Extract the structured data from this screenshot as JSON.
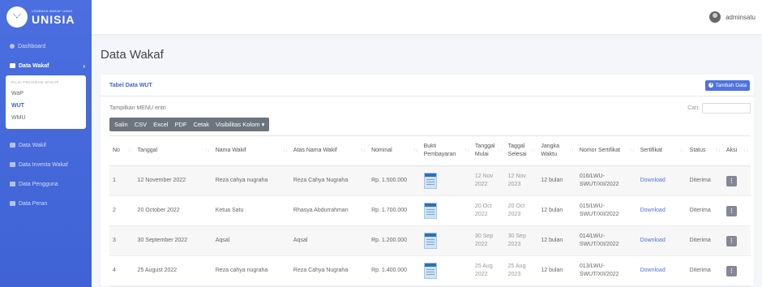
{
  "brand": {
    "small": "LEMBAGA WAKAF UANG",
    "big": "UNISIA"
  },
  "topbar": {
    "username": "adminsatu"
  },
  "sidebar": {
    "items": [
      {
        "label": "Dashboard",
        "icon": "dashboard-icon"
      },
      {
        "label": "Data Wakaf",
        "icon": "folder-icon",
        "active": true
      },
      {
        "label": "Data Wakif",
        "icon": "folder-icon"
      },
      {
        "label": "Data Investa Wakaf",
        "icon": "folder-icon"
      },
      {
        "label": "Data Pengguna",
        "icon": "folder-icon"
      },
      {
        "label": "Data Peran",
        "icon": "folder-icon"
      }
    ],
    "submenu": {
      "heading": "PILIH PROGRAM WAKAF",
      "items": [
        "WaP",
        "WUT",
        "WMU"
      ]
    }
  },
  "page": {
    "title": "Data Wakaf"
  },
  "card": {
    "title": "Tabel Data WUT",
    "add_button": "Tambah Data",
    "show_entries": "Tampilkan MENU entri",
    "search_label": "Cari:",
    "buttons": [
      "Salin",
      "CSV",
      "Excel",
      "PDF",
      "Cetak",
      "Visibilitas Kolom ▾"
    ]
  },
  "table": {
    "headers": [
      "No",
      "Tanggal",
      "Nama Wakif",
      "Atas Nama Wakif",
      "Nominal",
      "Bukti Pembayaran",
      "Tanggal Mulai",
      "Taggal Selesai",
      "Jangka Waktu",
      "Nomor Sertifikat",
      "Sertifikat",
      "Status",
      "Aksi"
    ],
    "rows": [
      {
        "no": "1",
        "tanggal": "12 November 2022",
        "nama": "Reza cahya nugraha",
        "atas": "Reza Cahya Nugraha",
        "nominal": "Rp. 1.500.000",
        "mulai": "12 Nov 2022",
        "selesai": "12 Nov 2023",
        "jangka": "12 bulan",
        "nomor": "016/LWU-SWUT/XII/2022",
        "sertifikat": "Download",
        "status": "Diterima",
        "aksi": "⋮"
      },
      {
        "no": "2",
        "tanggal": "20 October 2022",
        "nama": "Ketua Satu",
        "atas": "Rhasya Abdurrahman",
        "nominal": "Rp. 1.700.000",
        "mulai": "20 Oct 2022",
        "selesai": "20 Oct 2023",
        "jangka": "12 bulan",
        "nomor": "015/LWU-SWUT/XII/2022",
        "sertifikat": "Download",
        "status": "Diterima",
        "aksi": "⋮"
      },
      {
        "no": "3",
        "tanggal": "30 September 2022",
        "nama": "Aqsal",
        "atas": "Aqsal",
        "nominal": "Rp. 1.200.000",
        "mulai": "30 Sep 2022",
        "selesai": "30 Sep 2023",
        "jangka": "12 bulan",
        "nomor": "014/LWU-SWUT/XII/2022",
        "sertifikat": "Download",
        "status": "Diterima",
        "aksi": "⋮"
      },
      {
        "no": "4",
        "tanggal": "25 August 2022",
        "nama": "Reza cahya nugraha",
        "atas": "Reza Cahya Nugraha",
        "nominal": "Rp. 1.400.000",
        "mulai": "25 Aug 2022",
        "selesai": "25 Aug 2023",
        "jangka": "12 bulan",
        "nomor": "013/LWU-SWUT/XII/2022",
        "sertifikat": "Download",
        "status": "Diterima",
        "aksi": "⋮"
      }
    ]
  },
  "colors": {
    "primary": "#4e73df",
    "sidebar": "#3f62d4",
    "button_gray": "#6c757d"
  }
}
